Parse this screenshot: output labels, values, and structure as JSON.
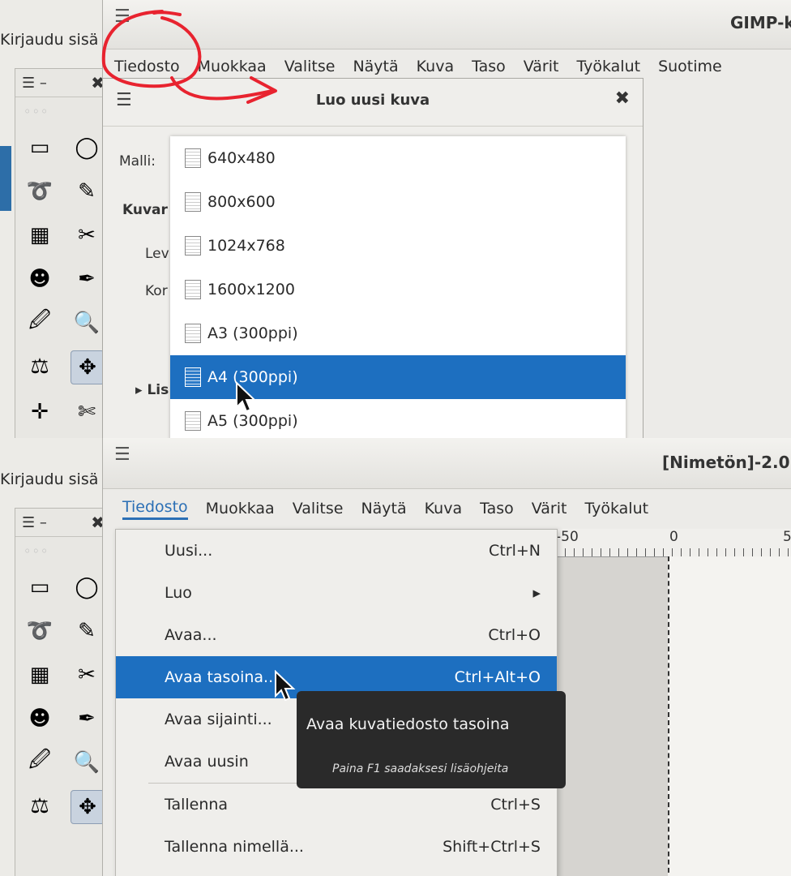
{
  "login_text": "Kirjaudu sisä",
  "top": {
    "window_title": "GIMP-k",
    "menubar": [
      "Tiedosto",
      "Muokkaa",
      "Valitse",
      "Näytä",
      "Kuva",
      "Taso",
      "Värit",
      "Työkalut",
      "Suotime"
    ],
    "dialog": {
      "title": "Luo uusi kuva",
      "template_label": "Malli:",
      "section_label": "Kuvar",
      "width_label": "Lev",
      "height_label": "Kor",
      "advanced_label": "Lis",
      "templates": [
        "640x480",
        "800x600",
        "1024x768",
        "1600x1200",
        "A3 (300ppi)",
        "A4 (300ppi)",
        "A5 (300ppi)"
      ],
      "selected_template": "A4 (300ppi)"
    }
  },
  "bottom": {
    "window_title": "[Nimetön]-2.0",
    "menubar": [
      "Tiedosto",
      "Muokkaa",
      "Valitse",
      "Näytä",
      "Kuva",
      "Taso",
      "Värit",
      "Työkalut"
    ],
    "file_menu": [
      {
        "label": "Uusi...",
        "shortcut": "Ctrl+N"
      },
      {
        "label": "Luo",
        "shortcut": "▸"
      },
      {
        "label": "Avaa...",
        "shortcut": "Ctrl+O"
      },
      {
        "label": "Avaa tasoina...",
        "shortcut": "Ctrl+Alt+O"
      },
      {
        "label": "Avaa sijainti...",
        "shortcut": ""
      },
      {
        "label": "Avaa uusin",
        "shortcut": ""
      },
      {
        "label": "Tallenna",
        "shortcut": "Ctrl+S"
      },
      {
        "label": "Tallenna nimellä...",
        "shortcut": "Shift+Ctrl+S"
      }
    ],
    "selected_item": "Avaa tasoina...",
    "ruler_labels": [
      "-50",
      "0",
      "5"
    ],
    "tooltip": {
      "title": "Avaa kuvatiedosto tasoina",
      "hint": "Paina F1 saadaksesi lisäohjeita"
    }
  },
  "toolbox": {
    "close": "✖",
    "menu": "☰ –"
  },
  "accent_color": "#1d6fc0",
  "annotation_color": "#e8232f"
}
